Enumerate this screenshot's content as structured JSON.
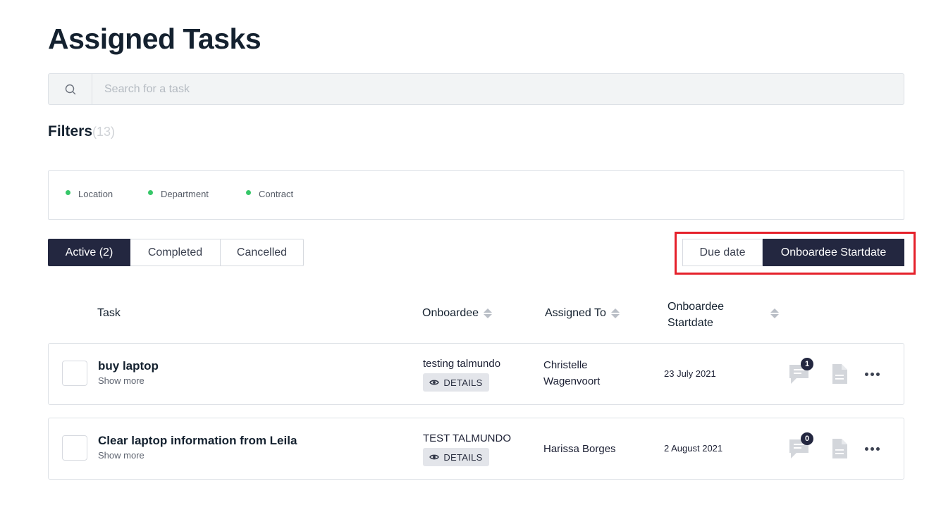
{
  "page": {
    "title": "Assigned Tasks"
  },
  "search": {
    "placeholder": "Search for a task"
  },
  "filters": {
    "title": "Filters",
    "count": "(13)",
    "chips": [
      "Location",
      "Department",
      "Contract"
    ]
  },
  "tabs": [
    {
      "label": "Active (2)",
      "active": true
    },
    {
      "label": "Completed",
      "active": false
    },
    {
      "label": "Cancelled",
      "active": false
    }
  ],
  "sort_toggle": [
    {
      "label": "Due date",
      "active": false
    },
    {
      "label": "Onboardee Startdate",
      "active": true
    }
  ],
  "table": {
    "headers": {
      "task": "Task",
      "onboardee": "Onboardee",
      "assigned_to": "Assigned To",
      "startdate_line1": "Onboardee",
      "startdate_line2": "Startdate"
    },
    "rows": [
      {
        "task": "buy laptop",
        "show_more": "Show more",
        "onboardee": "testing talmundo",
        "details": "DETAILS",
        "assigned_line1": "Christelle",
        "assigned_line2": "Wagenvoort",
        "startdate": "23 July 2021",
        "comments": "1"
      },
      {
        "task": "Clear laptop information from Leila",
        "show_more": "Show more",
        "onboardee": "TEST TALMUNDO",
        "details": "DETAILS",
        "assigned_line1": "Harissa Borges",
        "assigned_line2": "",
        "startdate": "2 August 2021",
        "comments": "0"
      }
    ]
  },
  "colors": {
    "primary_dark": "#232740",
    "accent_green": "#36c768",
    "highlight_red": "#e5212b"
  }
}
